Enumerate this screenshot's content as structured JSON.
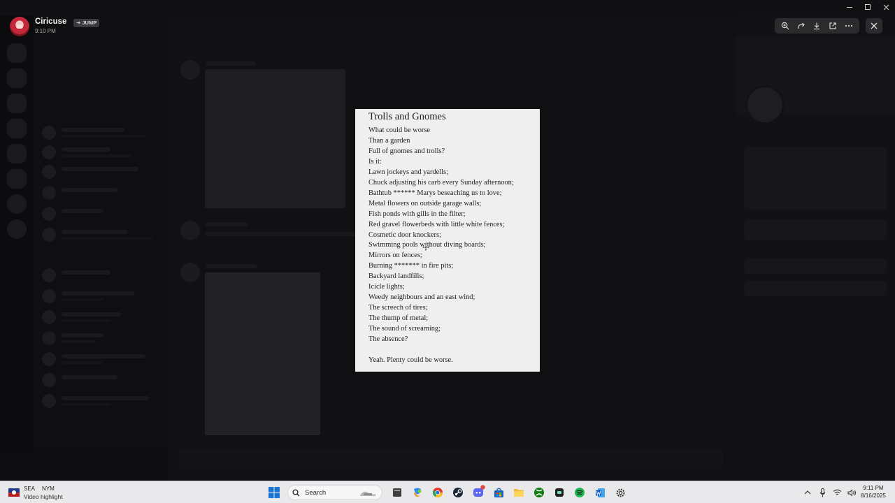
{
  "viewer": {
    "username": "Ciricuse",
    "jump_label": "JUMP",
    "timestamp": "9:10 PM"
  },
  "poem": {
    "title": "Trolls and Gnomes",
    "lines": [
      "What could be worse",
      "Than a garden",
      "Full of gnomes and trolls?",
      "Is it:",
      "Lawn jockeys and yardells;",
      "Chuck adjusting his carb every Sunday afternoon;",
      "Bathtub ****** Marys beseaching us to love;",
      "Metal flowers on outside garage walls;",
      "Fish ponds with gills in the filter;",
      "Red gravel flowerbeds with little white fences;",
      "Cosmetic door knockers;",
      "Swimming pools without diving boards;",
      "Mirrors on fences;",
      "Burning ******* in fire pits;",
      "Backyard landfills;",
      "Icicle lights;",
      "Weedy neighbours and an east wind;",
      "The screech of tires;",
      "The thump of metal;",
      "The sound of screaming;",
      "The absence?",
      "",
      "Yeah. Plenty could be worse."
    ]
  },
  "toolbar": {
    "icons": [
      "zoom-in-icon",
      "share-icon",
      "download-icon",
      "open-external-icon",
      "more-icon"
    ],
    "close_icon": "close-icon"
  },
  "taskbar": {
    "news_team_a": "SEA",
    "news_team_b": "NYM",
    "news_subtitle": "Video highlight",
    "search_placeholder": "Search",
    "time": "9:11 PM",
    "date": "8/16/2025",
    "pinned_apps": [
      "file-explorer-icon",
      "copilot-icon",
      "chrome-icon",
      "steam-icon",
      "discord-icon",
      "store-icon",
      "folder-icon",
      "xbox-icon",
      "media-player-icon",
      "spotify-icon",
      "word-icon",
      "settings-icon"
    ],
    "accent_blue": "#0a64c8",
    "accent_green": "#1db954"
  }
}
